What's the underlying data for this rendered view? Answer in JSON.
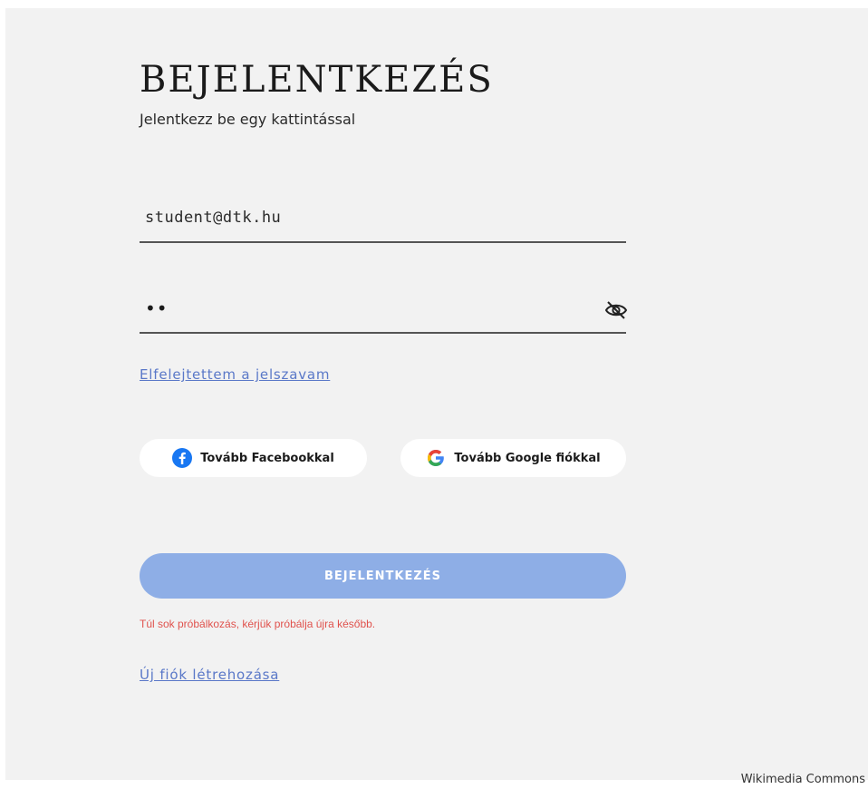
{
  "header": {
    "title": "BEJELENTKEZÉS",
    "subtitle": "Jelentkezz be egy kattintással"
  },
  "form": {
    "email_value": "student@dtk.hu",
    "password_masked": "••",
    "forgot_password_label": "Elfelejtettem a jelszavam",
    "facebook_label": "Tovább Facebookkal",
    "google_label": "Tovább Google fiókkal",
    "submit_label": "BEJELENTKEZÉS",
    "error_message": "Túl sok próbálkozás, kérjük próbálja újra később.",
    "signup_label": "Új fiók létrehozása"
  },
  "icons": {
    "password_toggle": "eye-slash-icon",
    "facebook": "facebook-icon",
    "google": "google-icon"
  },
  "colors": {
    "background": "#f2f2f2",
    "accent": "#8eaee6",
    "link": "#5a78c8",
    "error": "#e0524d"
  },
  "attribution": "Wikimedia Commons"
}
